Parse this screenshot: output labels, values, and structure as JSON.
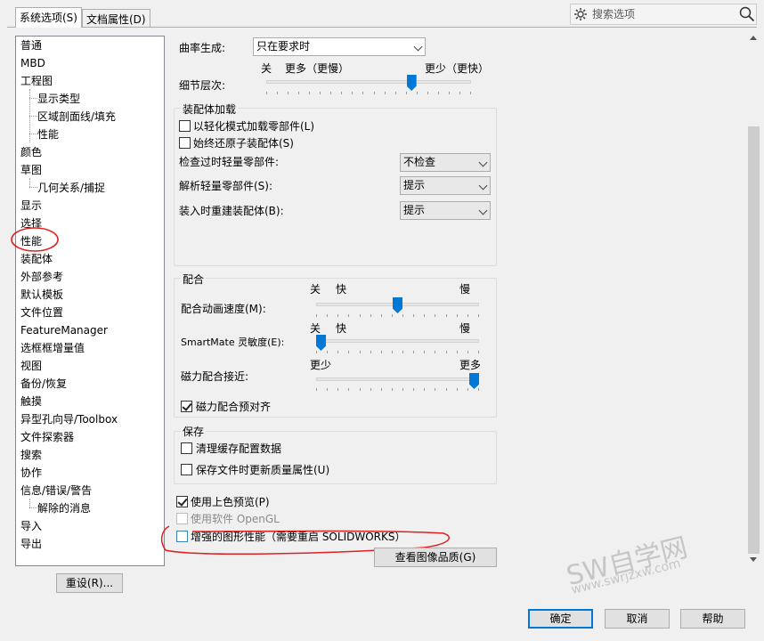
{
  "tabs": {
    "system_options": "系统选项(S)",
    "document_properties": "文档属性(D)"
  },
  "search": {
    "placeholder": "搜索选项"
  },
  "tree": {
    "items": [
      "普通",
      "MBD",
      "工程图",
      "显示类型",
      "区域剖面线/填充",
      "性能",
      "颜色",
      "草图",
      "几何关系/捕捉",
      "显示",
      "选择",
      "性能",
      "装配体",
      "外部参考",
      "默认模板",
      "文件位置",
      "FeatureManager",
      "选框框增量值",
      "视图",
      "备份/恢复",
      "触摸",
      "异型孔向导/Toolbox",
      "文件探索器",
      "搜索",
      "协作",
      "信息/错误/警告",
      "解除的消息",
      "导入",
      "导出"
    ],
    "selected": "性能"
  },
  "reset_button": "重设(R)...",
  "curvature": {
    "label": "曲率生成:",
    "value": "只在要求时"
  },
  "detail": {
    "label": "细节层次:",
    "left_off": "关",
    "left_more": "更多（更慢）",
    "right_less": "更少（更快）",
    "level": 0.72
  },
  "assembly": {
    "title": "装配体加载",
    "lightweight_label": "以轻化模式加载零部件(L)",
    "lightweight_checked": false,
    "always_resolve_label": "始终还原子装配体(S)",
    "always_resolve_checked": false,
    "check_outdated_label": "检查过时轻量零部件:",
    "check_outdated_value": "不检查",
    "resolve_light_label": "解析轻量零部件(S):",
    "resolve_light_value": "提示",
    "rebuild_label": "装入时重建装配体(B):",
    "rebuild_value": "提示"
  },
  "mates": {
    "title": "配合",
    "anim_off": "关",
    "anim_fast": "快",
    "anim_slow": "慢",
    "anim_label": "配合动画速度(M):",
    "anim_level": 0.5,
    "smartmate_off": "关",
    "smartmate_fast": "快",
    "smartmate_slow": "慢",
    "smartmate_label": "SmartMate 灵敏度(E):",
    "smartmate_level": 0.0,
    "magnetic_less": "更少",
    "magnetic_more": "更多",
    "magnetic_label": "磁力配合接近:",
    "magnetic_level": 1.0,
    "prealign_label": "磁力配合预对齐",
    "prealign_checked": true
  },
  "save": {
    "title": "保存",
    "purge_label": "清理缓存配置数据",
    "purge_checked": false,
    "update_mass_label": "保存文件时更新质量属性(U)",
    "update_mass_checked": false
  },
  "shaded_preview": {
    "label": "使用上色预览(P)",
    "checked": true
  },
  "software_opengl": {
    "label": "使用软件 OpenGL",
    "checked": false
  },
  "enhanced_graphics": {
    "label": "增强的图形性能（需要重启 SOLIDWORKS）",
    "checked": false
  },
  "image_quality_button": "查看图像品质(G)",
  "footer": {
    "ok": "确定",
    "cancel": "取消",
    "help": "帮助"
  },
  "watermark": {
    "title": "SW自学网",
    "url": "www.swrjzxw.com"
  },
  "colors": {
    "accent": "#0078d7",
    "annotation": "#e02020"
  }
}
